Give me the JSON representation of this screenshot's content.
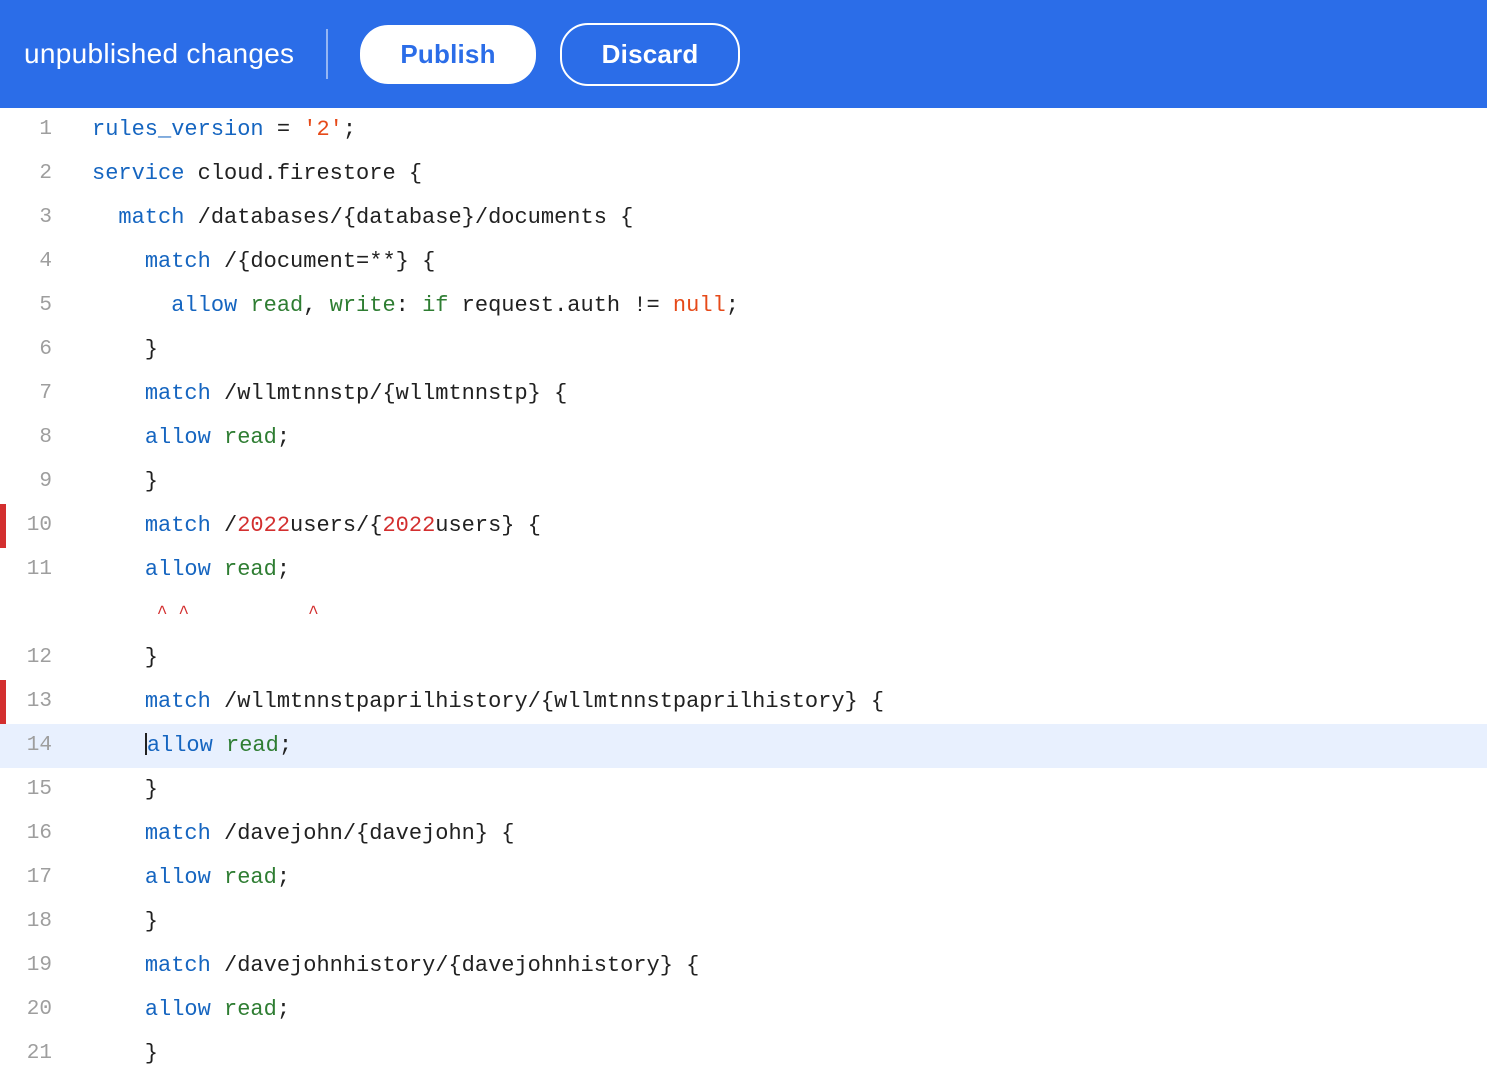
{
  "header": {
    "unpublished_label": "unpublished changes",
    "publish_label": "Publish",
    "discard_label": "Discard",
    "bg_color": "#2b6de8"
  },
  "editor": {
    "lines": [
      {
        "num": 1,
        "tokens": [
          {
            "t": "kw",
            "v": "rules_version"
          },
          {
            "t": "plain",
            "v": " = "
          },
          {
            "t": "str",
            "v": "'2'"
          },
          {
            "t": "plain",
            "v": ";"
          }
        ],
        "highlighted": false,
        "error": false
      },
      {
        "num": 2,
        "tokens": [
          {
            "t": "kw",
            "v": "service"
          },
          {
            "t": "plain",
            "v": " cloud.firestore {"
          }
        ],
        "highlighted": false,
        "error": false
      },
      {
        "num": 3,
        "tokens": [
          {
            "t": "plain",
            "v": "  "
          },
          {
            "t": "kw",
            "v": "match"
          },
          {
            "t": "plain",
            "v": " /databases/{database}/documents {"
          }
        ],
        "highlighted": false,
        "error": false
      },
      {
        "num": 4,
        "tokens": [
          {
            "t": "plain",
            "v": "    "
          },
          {
            "t": "kw",
            "v": "match"
          },
          {
            "t": "plain",
            "v": " /{document=**} {"
          }
        ],
        "highlighted": false,
        "error": false
      },
      {
        "num": 5,
        "tokens": [
          {
            "t": "plain",
            "v": "      "
          },
          {
            "t": "kw",
            "v": "allow"
          },
          {
            "t": "plain",
            "v": " "
          },
          {
            "t": "kw-green",
            "v": "read"
          },
          {
            "t": "plain",
            "v": ", "
          },
          {
            "t": "kw-green",
            "v": "write"
          },
          {
            "t": "plain",
            "v": ": "
          },
          {
            "t": "kw-green",
            "v": "if"
          },
          {
            "t": "plain",
            "v": " request.auth != "
          },
          {
            "t": "str",
            "v": "null"
          },
          {
            "t": "plain",
            "v": ";"
          }
        ],
        "highlighted": false,
        "error": false
      },
      {
        "num": 6,
        "tokens": [
          {
            "t": "plain",
            "v": "    }"
          }
        ],
        "highlighted": false,
        "error": false
      },
      {
        "num": 7,
        "tokens": [
          {
            "t": "plain",
            "v": "    "
          },
          {
            "t": "kw",
            "v": "match"
          },
          {
            "t": "plain",
            "v": " /wllmtnnstp/{wllmtnnstp} {"
          }
        ],
        "highlighted": false,
        "error": false
      },
      {
        "num": 8,
        "tokens": [
          {
            "t": "plain",
            "v": "    "
          },
          {
            "t": "kw",
            "v": "allow"
          },
          {
            "t": "plain",
            "v": " "
          },
          {
            "t": "kw-green",
            "v": "read"
          },
          {
            "t": "plain",
            "v": ";"
          }
        ],
        "highlighted": false,
        "error": false
      },
      {
        "num": 9,
        "tokens": [
          {
            "t": "plain",
            "v": "    }"
          }
        ],
        "highlighted": false,
        "error": false
      },
      {
        "num": 10,
        "tokens": [
          {
            "t": "plain",
            "v": "    "
          },
          {
            "t": "kw",
            "v": "match"
          },
          {
            "t": "plain",
            "v": " /"
          },
          {
            "t": "num-red",
            "v": "2022"
          },
          {
            "t": "plain",
            "v": "users/{"
          },
          {
            "t": "num-red",
            "v": "2022"
          },
          {
            "t": "plain",
            "v": "users} {"
          }
        ],
        "highlighted": false,
        "error": true
      },
      {
        "num": 11,
        "tokens": [
          {
            "t": "plain",
            "v": "    "
          },
          {
            "t": "kw",
            "v": "allow"
          },
          {
            "t": "plain",
            "v": " "
          },
          {
            "t": "kw-green",
            "v": "read"
          },
          {
            "t": "plain",
            "v": ";"
          }
        ],
        "highlighted": false,
        "error": false,
        "carets": "      ^ ^           ^"
      },
      {
        "num": 12,
        "tokens": [
          {
            "t": "plain",
            "v": "    }"
          }
        ],
        "highlighted": false,
        "error": false
      },
      {
        "num": 13,
        "tokens": [
          {
            "t": "plain",
            "v": "    "
          },
          {
            "t": "kw",
            "v": "match"
          },
          {
            "t": "plain",
            "v": " /wllmtnnstpaprilhistory/{wllmtnnstpaprilhistory} {"
          }
        ],
        "highlighted": false,
        "error": true
      },
      {
        "num": 14,
        "tokens": [
          {
            "t": "plain",
            "v": "    "
          },
          {
            "t": "kw",
            "v": "allow"
          },
          {
            "t": "plain",
            "v": " "
          },
          {
            "t": "kw-green",
            "v": "read"
          },
          {
            "t": "plain",
            "v": ";"
          }
        ],
        "highlighted": true,
        "error": false,
        "cursor": true
      },
      {
        "num": 15,
        "tokens": [
          {
            "t": "plain",
            "v": "    }"
          }
        ],
        "highlighted": false,
        "error": false
      },
      {
        "num": 16,
        "tokens": [
          {
            "t": "plain",
            "v": "    "
          },
          {
            "t": "kw",
            "v": "match"
          },
          {
            "t": "plain",
            "v": " /davejohn/{davejohn} {"
          }
        ],
        "highlighted": false,
        "error": false
      },
      {
        "num": 17,
        "tokens": [
          {
            "t": "plain",
            "v": "    "
          },
          {
            "t": "kw",
            "v": "allow"
          },
          {
            "t": "plain",
            "v": " "
          },
          {
            "t": "kw-green",
            "v": "read"
          },
          {
            "t": "plain",
            "v": ";"
          }
        ],
        "highlighted": false,
        "error": false
      },
      {
        "num": 18,
        "tokens": [
          {
            "t": "plain",
            "v": "    }"
          }
        ],
        "highlighted": false,
        "error": false
      },
      {
        "num": 19,
        "tokens": [
          {
            "t": "plain",
            "v": "    "
          },
          {
            "t": "kw",
            "v": "match"
          },
          {
            "t": "plain",
            "v": " /davejohnhistory/{davejohnhistory} {"
          }
        ],
        "highlighted": false,
        "error": false
      },
      {
        "num": 20,
        "tokens": [
          {
            "t": "plain",
            "v": "    "
          },
          {
            "t": "kw",
            "v": "allow"
          },
          {
            "t": "plain",
            "v": " "
          },
          {
            "t": "kw-green",
            "v": "read"
          },
          {
            "t": "plain",
            "v": ";"
          }
        ],
        "highlighted": false,
        "error": false
      },
      {
        "num": 21,
        "tokens": [
          {
            "t": "plain",
            "v": "    }"
          }
        ],
        "highlighted": false,
        "error": false
      }
    ]
  }
}
